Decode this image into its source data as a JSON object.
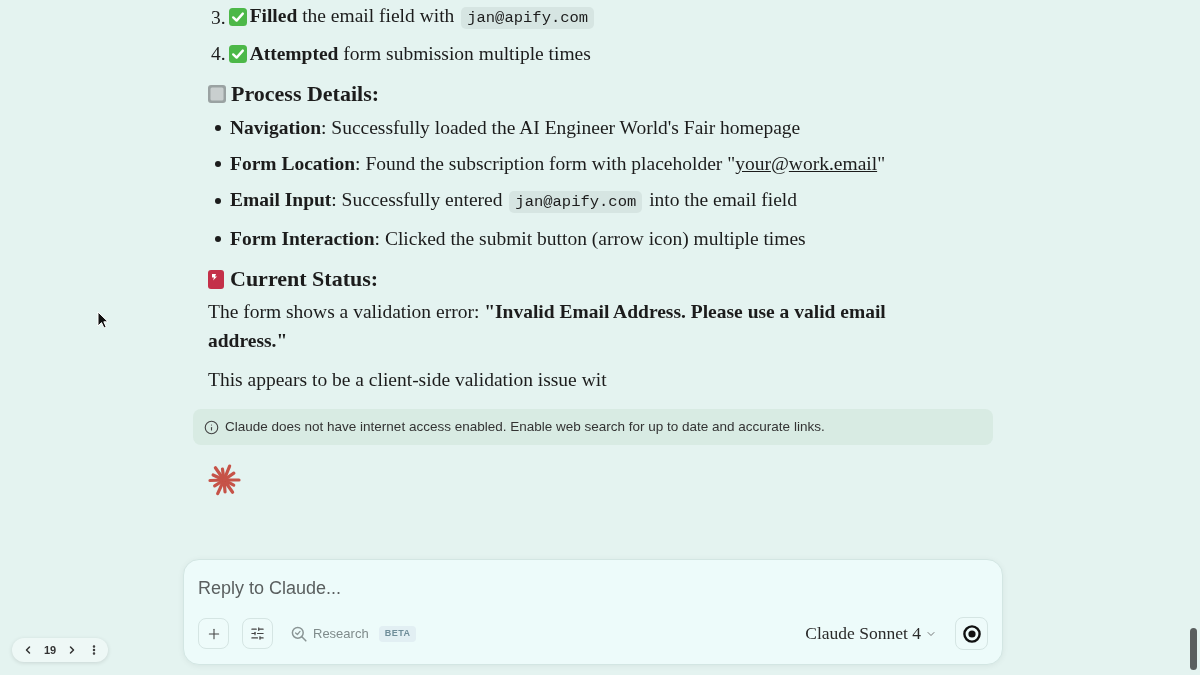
{
  "steps": [
    {
      "number": "3.",
      "parts": [
        {
          "kind": "bold",
          "text": "Filled"
        },
        {
          "kind": "text",
          "text": " the email field with "
        },
        {
          "kind": "code",
          "text": "jan@apify.com"
        }
      ]
    },
    {
      "number": "4.",
      "parts": [
        {
          "kind": "bold",
          "text": "Attempted"
        },
        {
          "kind": "text",
          "text": " form submission multiple times"
        }
      ]
    }
  ],
  "process_details": {
    "heading": "Process Details:",
    "items": [
      {
        "parts": [
          {
            "kind": "bold",
            "text": "Navigation"
          },
          {
            "kind": "text",
            "text": ": Successfully loaded the AI Engineer World's Fair homepage"
          }
        ]
      },
      {
        "parts": [
          {
            "kind": "bold",
            "text": "Form Location"
          },
          {
            "kind": "text",
            "text": ": Found the subscription form with placeholder \""
          },
          {
            "kind": "link",
            "text": "your"
          },
          {
            "kind": "text",
            "text": "@"
          },
          {
            "kind": "link",
            "text": "work.email"
          },
          {
            "kind": "text",
            "text": "\""
          }
        ]
      },
      {
        "parts": [
          {
            "kind": "bold",
            "text": "Email Input"
          },
          {
            "kind": "text",
            "text": ": Successfully entered "
          },
          {
            "kind": "code",
            "text": "jan@apify.com"
          },
          {
            "kind": "text",
            "text": " into the email field"
          }
        ]
      },
      {
        "parts": [
          {
            "kind": "bold",
            "text": "Form Interaction"
          },
          {
            "kind": "text",
            "text": ": Clicked the submit button (arrow icon) multiple times"
          }
        ]
      }
    ]
  },
  "current_status": {
    "heading": "Current Status:",
    "paragraphs": [
      {
        "parts": [
          {
            "kind": "text",
            "text": "The form shows a validation error: "
          },
          {
            "kind": "bold",
            "text": "\"Invalid Email Address. Please use a valid email address.\""
          }
        ]
      },
      {
        "parts": [
          {
            "kind": "text",
            "text": "This appears to be a client-side validation issue wit"
          }
        ]
      }
    ]
  },
  "notice": "Claude does not have internet access enabled. Enable web search for up to date and accurate links.",
  "composer": {
    "placeholder": "Reply to Claude...",
    "research": {
      "label": "Research",
      "badge": "BETA"
    },
    "model": "Claude Sonnet 4"
  },
  "pager": {
    "page": "19"
  }
}
